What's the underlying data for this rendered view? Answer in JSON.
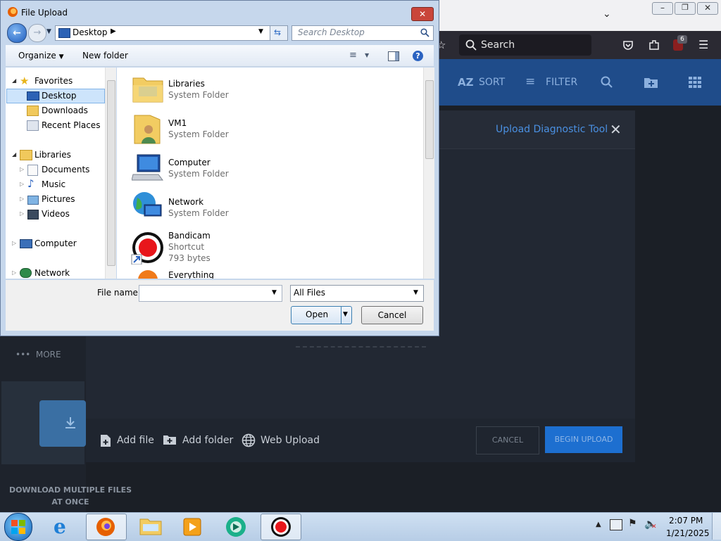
{
  "browser": {
    "search_placeholder": "Search",
    "badge_count": "6"
  },
  "app_header": {
    "sort_label": "SORT",
    "filter_label": "FILTER"
  },
  "left_panel": {
    "more_label": "MORE",
    "download_text_line1": "DOWNLOAD MULTIPLE FILES",
    "download_text_line2": "AT ONCE"
  },
  "upload_modal": {
    "title": "Upload Diagnostic Tool",
    "add_file": "Add file",
    "add_folder": "Add folder",
    "web_upload": "Web Upload",
    "cancel": "CANCEL",
    "begin_upload": "BEGIN UPLOAD"
  },
  "dialog": {
    "title": "File Upload",
    "address": "Desktop",
    "search_placeholder": "Search Desktop",
    "organize": "Organize",
    "new_folder": "New folder",
    "nav": {
      "favorites": "Favorites",
      "desktop": "Desktop",
      "downloads": "Downloads",
      "recent_places": "Recent Places",
      "libraries": "Libraries",
      "documents": "Documents",
      "music": "Music",
      "pictures": "Pictures",
      "videos": "Videos",
      "computer": "Computer",
      "network": "Network"
    },
    "files": [
      {
        "name": "Libraries",
        "sub": "System Folder"
      },
      {
        "name": "VM1",
        "sub": "System Folder"
      },
      {
        "name": "Computer",
        "sub": "System Folder"
      },
      {
        "name": "Network",
        "sub": "System Folder"
      },
      {
        "name": "Bandicam",
        "sub": "Shortcut",
        "sub2": "793 bytes"
      },
      {
        "name": "Everything",
        "sub": ""
      }
    ],
    "file_name_label": "File name:",
    "file_name_value": "",
    "file_type": "All Files",
    "open": "Open",
    "cancel": "Cancel"
  },
  "taskbar": {
    "time": "2:07 PM",
    "date": "1/21/2025"
  }
}
